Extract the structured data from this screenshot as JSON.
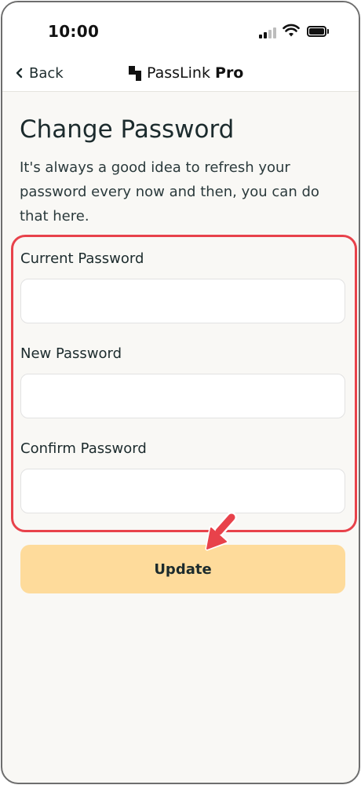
{
  "status_bar": {
    "time": "10:00"
  },
  "nav": {
    "back_label": "Back",
    "brand_name": "PassLink",
    "brand_suffix": "Pro",
    "back_icon": "chevron-left-icon",
    "logo_icon": "passlink-logo-icon"
  },
  "page": {
    "title": "Change Password",
    "description": "It's always a good idea to refresh your password every now and then, you can do that here."
  },
  "form": {
    "current_password": {
      "label": "Current Password",
      "value": "",
      "placeholder": ""
    },
    "new_password": {
      "label": "New Password",
      "value": "",
      "placeholder": ""
    },
    "confirm_password": {
      "label": "Confirm Password",
      "value": "",
      "placeholder": ""
    }
  },
  "actions": {
    "update_label": "Update"
  },
  "colors": {
    "accent_button": "#fedb9b",
    "highlight_border": "#e8424b",
    "background": "#f9f8f5"
  }
}
